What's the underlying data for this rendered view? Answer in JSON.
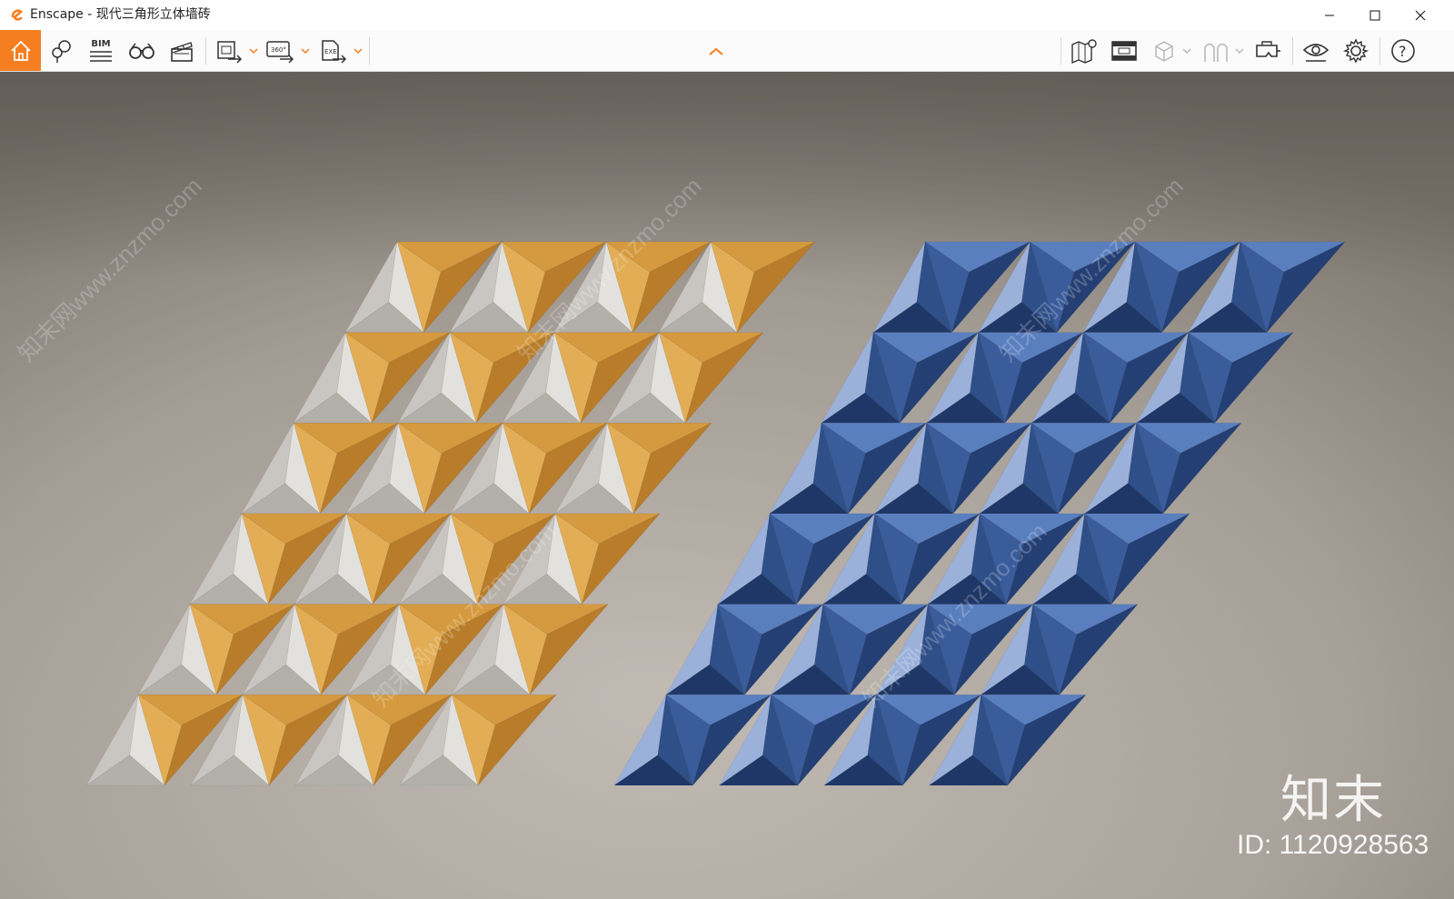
{
  "window": {
    "title": "Enscape - 现代三角形立体墙砖",
    "controls": [
      "minimize-icon",
      "maximize-icon",
      "close-icon"
    ]
  },
  "toolbar": {
    "left": [
      {
        "name": "home",
        "icon": "home-icon",
        "active": true
      },
      {
        "name": "views",
        "icon": "pin-views-icon"
      },
      {
        "name": "bim",
        "icon": "bim-icon",
        "label": "BIM"
      },
      {
        "name": "binoculars",
        "icon": "binoculars-icon"
      },
      {
        "name": "video-editor",
        "icon": "clapperboard-icon"
      },
      {
        "name": "screenshot-export",
        "icon": "image-export-icon",
        "dropdown": true
      },
      {
        "name": "panorama-export",
        "icon": "panorama-export-icon",
        "label": "360°",
        "dropdown": true
      },
      {
        "name": "exe-export",
        "icon": "exe-export-icon",
        "label": "EXE",
        "dropdown": true
      }
    ],
    "center": {
      "icon": "chevron-up-icon"
    },
    "right": [
      {
        "name": "map",
        "icon": "map-icon"
      },
      {
        "name": "cinema",
        "icon": "cinema-icon"
      },
      {
        "name": "cube-view",
        "icon": "cube-icon",
        "dropdown": true
      },
      {
        "name": "arches",
        "icon": "arches-icon",
        "dropdown": true
      },
      {
        "name": "vr",
        "icon": "vr-headset-icon"
      },
      {
        "name": "visual-settings",
        "icon": "eye-icon"
      },
      {
        "name": "settings",
        "icon": "gear-icon"
      },
      {
        "name": "help",
        "icon": "help-icon",
        "label": "?"
      }
    ]
  },
  "scene": {
    "description_colors": {
      "orange": "#d59a3f",
      "white": "#d8d6d2",
      "blue": "#2c4c86",
      "background": "#b4ada5"
    }
  },
  "watermark": {
    "logo": "知末",
    "id": "ID: 1120928563",
    "diagonal_text": "知末网www.znzmo.com"
  },
  "colors": {
    "accent": "#f57e20"
  }
}
